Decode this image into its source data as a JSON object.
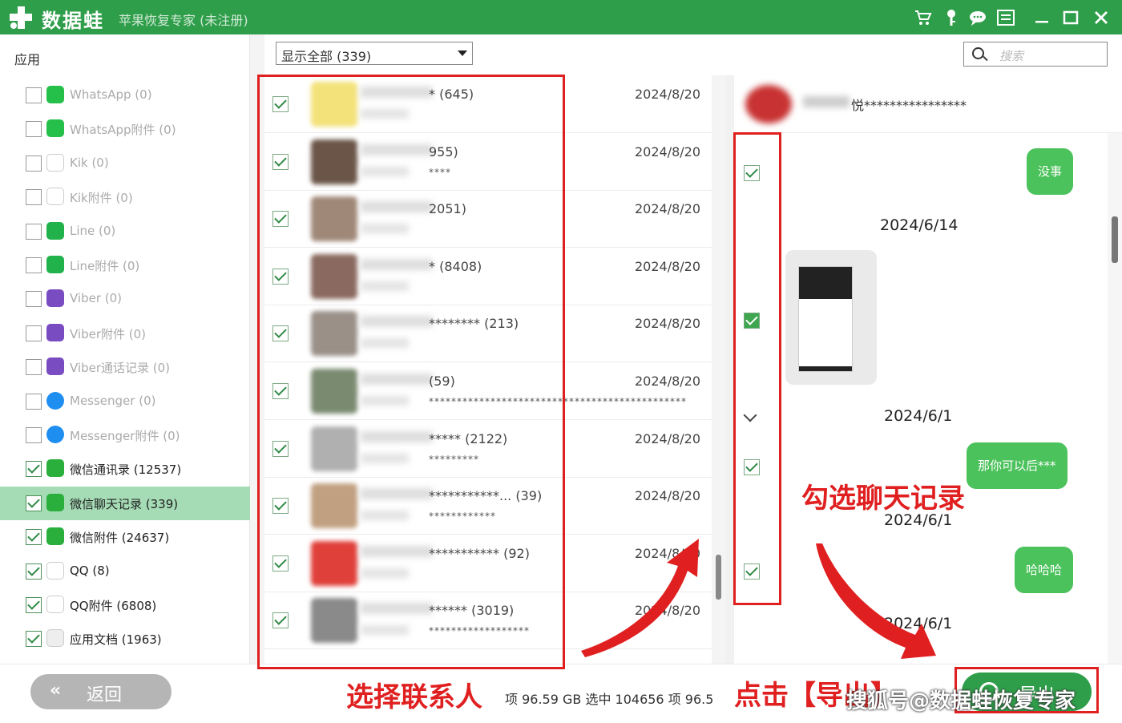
{
  "titlebar": {
    "brand": "数据蛙",
    "subtitle": "苹果恢复专家 (未注册)",
    "bg_color": "#2f9e4a"
  },
  "sidebar": {
    "title": "应用",
    "items": [
      {
        "label": "WhatsApp (0)",
        "checked": false,
        "icon": "whatsapp-icon"
      },
      {
        "label": "WhatsApp附件 (0)",
        "checked": false,
        "icon": "whatsapp-icon"
      },
      {
        "label": "Kik (0)",
        "checked": false,
        "icon": "kik-icon"
      },
      {
        "label": "Kik附件 (0)",
        "checked": false,
        "icon": "kik-icon"
      },
      {
        "label": "Line (0)",
        "checked": false,
        "icon": "line-icon"
      },
      {
        "label": "Line附件 (0)",
        "checked": false,
        "icon": "line-icon"
      },
      {
        "label": "Viber (0)",
        "checked": false,
        "icon": "viber-icon"
      },
      {
        "label": "Viber附件 (0)",
        "checked": false,
        "icon": "viber-icon"
      },
      {
        "label": "Viber通话记录 (0)",
        "checked": false,
        "icon": "viber-icon"
      },
      {
        "label": "Messenger (0)",
        "checked": false,
        "icon": "messenger-icon"
      },
      {
        "label": "Messenger附件 (0)",
        "checked": false,
        "icon": "messenger-icon"
      },
      {
        "label": "微信通讯录 (12537)",
        "checked": true,
        "icon": "wechat-icon"
      },
      {
        "label": "微信聊天记录 (339)",
        "checked": true,
        "icon": "wechat-icon",
        "selected": true
      },
      {
        "label": "微信附件 (24637)",
        "checked": true,
        "icon": "wechat-icon"
      },
      {
        "label": "QQ (8)",
        "checked": true,
        "icon": "qq-icon"
      },
      {
        "label": "QQ附件 (6808)",
        "checked": true,
        "icon": "qq-icon"
      },
      {
        "label": "应用文档 (1963)",
        "checked": true,
        "icon": "document-icon"
      }
    ]
  },
  "filter": {
    "value": "显示全部 (339)"
  },
  "search": {
    "placeholder": "搜索"
  },
  "contacts": [
    {
      "name": "* (645)",
      "msg": "",
      "date": "2024/8/20",
      "avatar_color": "#f3e27a"
    },
    {
      "name": "955)",
      "msg": "****",
      "date": "2024/8/20",
      "avatar_color": "#6b5548"
    },
    {
      "name": "2051)",
      "msg": "",
      "date": "2024/8/20",
      "avatar_color": "#a08878"
    },
    {
      "name": "* (8408)",
      "msg": "",
      "date": "2024/8/20",
      "avatar_color": "#8a6a60"
    },
    {
      "name": "******** (213)",
      "msg": "",
      "date": "2024/8/20",
      "avatar_color": "#9a9088"
    },
    {
      "name": "(59)",
      "msg": "**********************************************",
      "date": "2024/8/20",
      "avatar_color": "#7a8a70"
    },
    {
      "name": "***** (2122)",
      "msg": "*********",
      "date": "2024/8/20",
      "avatar_color": "#b0b0b0"
    },
    {
      "name": "***********... (39)",
      "msg": "************",
      "date": "2024/8/20",
      "avatar_color": "#c0a080"
    },
    {
      "name": "*********** (92)",
      "msg": "",
      "date": "2024/8/20",
      "avatar_color": "#e0403a"
    },
    {
      "name": "****** (3019)",
      "msg": "******************",
      "date": "2024/8/20",
      "avatar_color": "#8a8a8a"
    }
  ],
  "chat": {
    "name": "悦****************",
    "dates": [
      "2024/6/14",
      "2024/6/1",
      "2024/6/1",
      "2024/6/1"
    ],
    "bubbles": [
      "没事",
      "那你可以后***",
      "哈哈哈"
    ]
  },
  "bottom": {
    "back_label": "返回",
    "back_arrow": "«",
    "stats": "项 96.59 GB  选中 104656 项 96.5",
    "export_label": "导出"
  },
  "annotations": {
    "select_contacts": "选择联系人",
    "check_records": "勾选聊天记录",
    "click_export": "点击【导出】",
    "watermark": "搜狐号@数据蛙恢复专家",
    "color": "#e02020"
  }
}
